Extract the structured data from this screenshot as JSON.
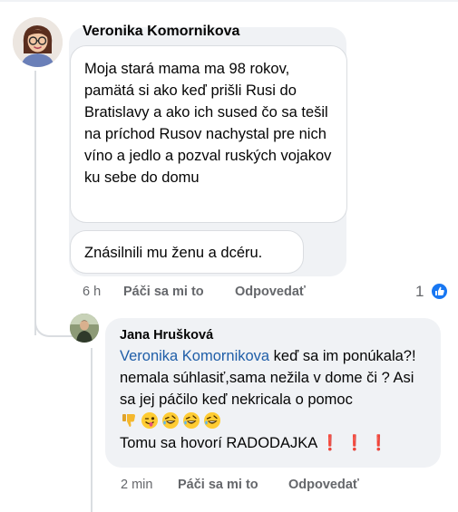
{
  "comment": {
    "author": "Veronika Komornikova",
    "paragraph_1": "Moja stará mama ma 98 rokov, pamätá si ako keď prišli Rusi do Bratislavy a ako ich sused čo sa tešil na príchod Rusov nachystal pre nich víno a jedlo a pozval ruských vojakov ku sebe do domu",
    "paragraph_2": "Znásilnili mu ženu a dcéru.",
    "time": "6 h",
    "like_label": "Páči sa mi to",
    "reply_label": "Odpovedať",
    "reaction_count": "1",
    "reaction_icon": "like-icon",
    "reaction_color": "#1877f2"
  },
  "reply": {
    "author": "Jana Hrušková",
    "mention": "Veronika Komornikova",
    "text_after_mention": " keď sa im ponúkala?! nemala súhlasiť,sama nežila v dome či ? Asi sa jej páčilo keď nekricala o pomoc ",
    "emojis": [
      "thumbs-down-emoji",
      "winking-tongue-emoji",
      "rofl-emoji",
      "rofl-emoji",
      "rofl-emoji"
    ],
    "line_last": "Tomu sa hovorí RADODAJKA",
    "exclamations": "❗❗❗",
    "time": "2 min",
    "like_label": "Páči sa mi to",
    "reply_label": "Odpovedať",
    "mention_color": "#1f5ea8"
  }
}
